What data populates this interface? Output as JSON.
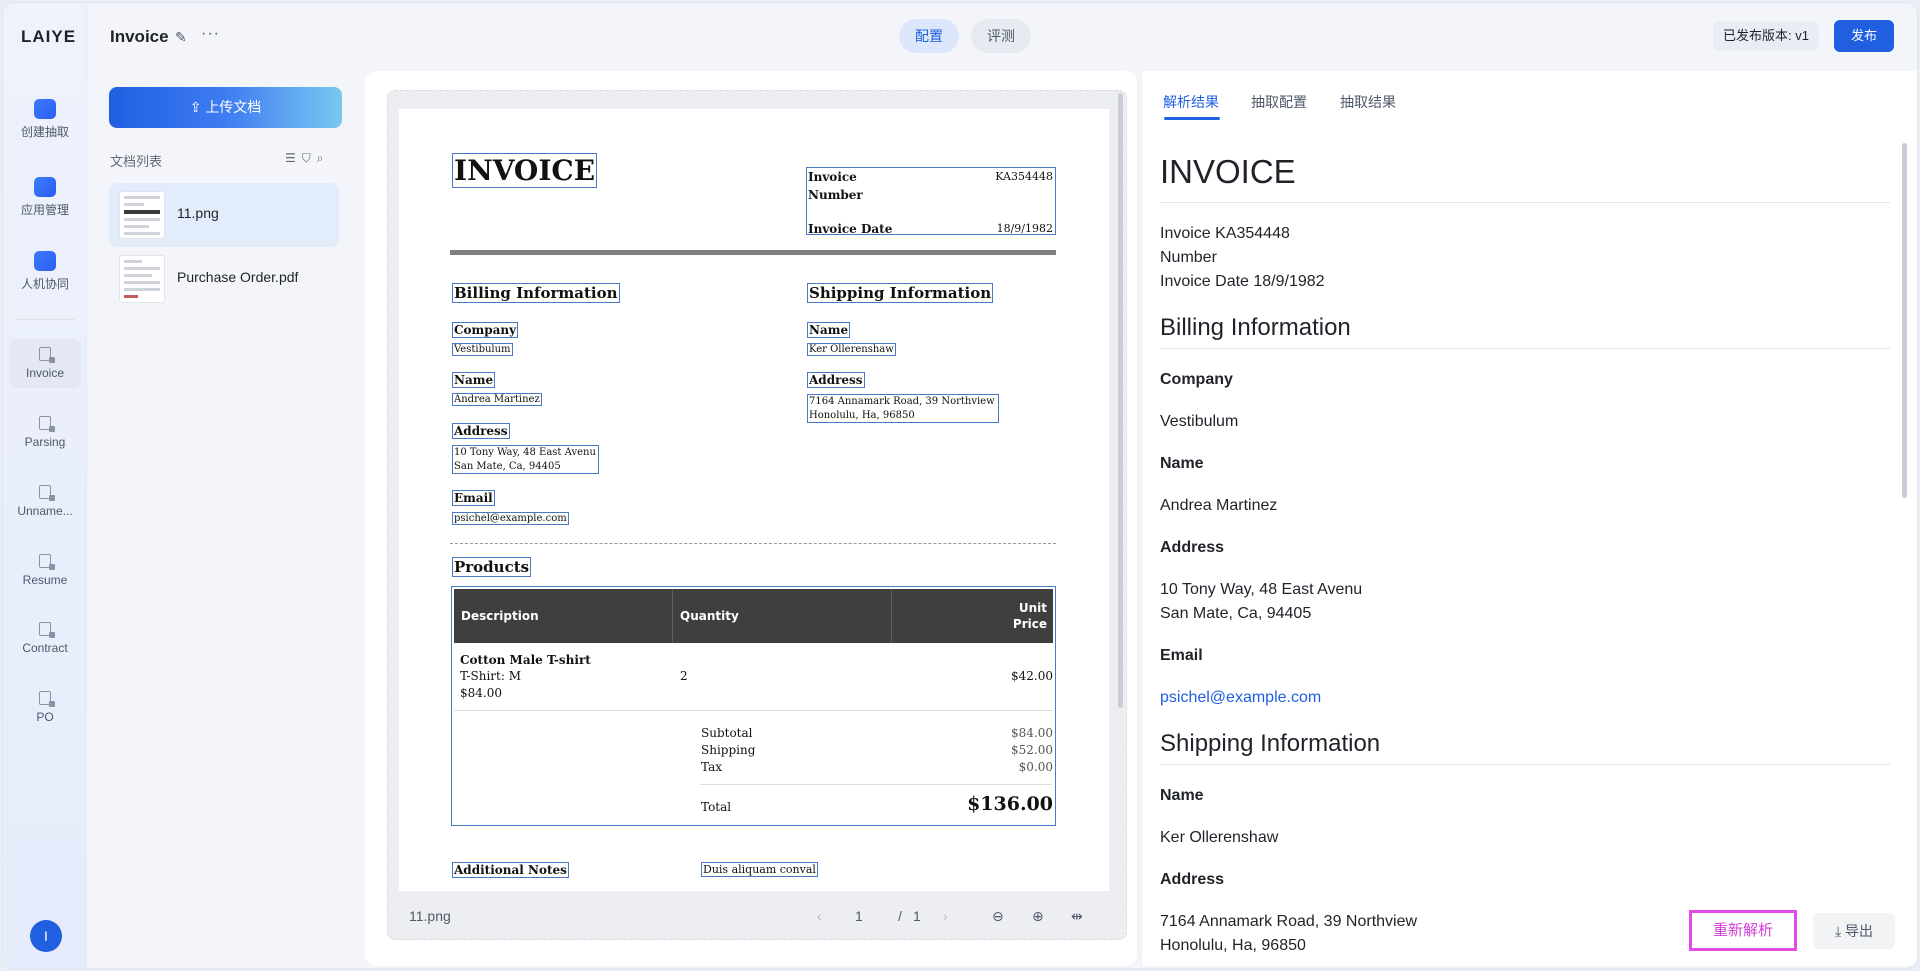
{
  "app": {
    "logo": "LAIYE",
    "doc_title": "Invoice",
    "avatar": "I"
  },
  "rail": {
    "main_items": [
      {
        "label": "创建抽取",
        "icon": "plus-square-icon"
      },
      {
        "label": "应用管理",
        "icon": "folder-icon"
      },
      {
        "label": "人机协同",
        "icon": "monitor-check-icon"
      }
    ],
    "doc_items": [
      "Invoice",
      "Parsing",
      "Unname...",
      "Resume",
      "Contract",
      "PO"
    ]
  },
  "header": {
    "tab_config": "配置",
    "tab_eval": "评测",
    "version": "已发布版本: v1",
    "publish": "发布"
  },
  "doclist": {
    "upload": "上传文档",
    "title": "文档列表",
    "files": [
      {
        "name": "11.png"
      },
      {
        "name": "Purchase Order.pdf"
      }
    ]
  },
  "paper": {
    "title": "INVOICE",
    "invoice_number_label1": "Invoice",
    "invoice_number_label2": "Number",
    "invoice_number": "KA354448",
    "invoice_date_label": "Invoice Date",
    "invoice_date": "18/9/1982",
    "billing_title": "Billing Information",
    "company_label": "Company",
    "company": "Vestibulum",
    "name_label": "Name",
    "name": "Andrea Martinez",
    "address_label": "Address",
    "address1": "10 Tony Way, 48 East Avenu",
    "address2": "San Mate, Ca, 94405",
    "email_label": "Email",
    "email": "psichel@example.com",
    "shipping_title": "Shipping Information",
    "ship_name_label": "Name",
    "ship_name": "Ker Ollerenshaw",
    "ship_address_label": "Address",
    "ship_address1": "7164 Annamark Road, 39 Northview",
    "ship_address2": "Honolulu, Ha, 96850",
    "products_title": "Products",
    "col_desc": "Description",
    "col_qty": "Quantity",
    "col_price1": "Unit",
    "col_price2": "Price",
    "item_name": "Cotton Male T-shirt",
    "item_variant": "T-Shirt: M",
    "item_total": "$84.00",
    "item_qty": "2",
    "item_price": "$42.00",
    "subtotal_label": "Subtotal",
    "subtotal": "$84.00",
    "shipping_label": "Shipping",
    "shipping": "$52.00",
    "tax_label": "Tax",
    "tax": "$0.00",
    "total_label": "Total",
    "total": "$136.00",
    "notes_label": "Additional Notes",
    "notes": "Duis aliquam conval"
  },
  "viewer_bar": {
    "file": "11.png",
    "page": "1",
    "page_sep": "/",
    "page_total": "1"
  },
  "right": {
    "tabs": [
      "解析结果",
      "抽取配置",
      "抽取结果"
    ],
    "h1": "INVOICE",
    "inv_line1": "Invoice KA354448",
    "inv_line2": "Number",
    "inv_line3": "Invoice Date 18/9/1982",
    "billing_h2": "Billing Information",
    "company_label": "Company",
    "company": "Vestibulum",
    "name_label": "Name",
    "name": "Andrea Martinez",
    "address_label": "Address",
    "address1": "10 Tony Way, 48 East Avenu",
    "address2": "San Mate, Ca, 94405",
    "email_label": "Email",
    "email": "psichel@example.com",
    "shipping_h2": "Shipping Information",
    "ship_name_label": "Name",
    "ship_name": "Ker Ollerenshaw",
    "ship_address_label": "Address",
    "ship_address1": "7164 Annamark Road, 39 Northview",
    "ship_address2": "Honolulu, Ha, 96850",
    "reparse": "重新解析",
    "export": "导出"
  }
}
